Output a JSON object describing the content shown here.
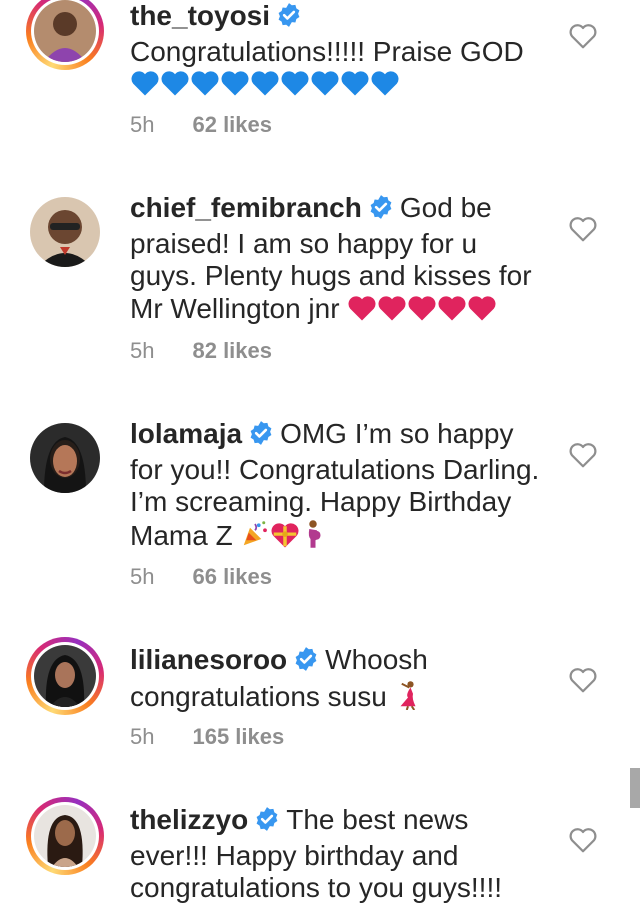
{
  "comments": [
    {
      "username": "the_toyosi",
      "text": "Congratulations!!!!! Praise GOD",
      "emojis": [
        "blue-heart",
        "blue-heart",
        "blue-heart",
        "blue-heart",
        "blue-heart",
        "blue-heart",
        "blue-heart",
        "blue-heart",
        "blue-heart"
      ],
      "time": "5h",
      "likes": "62 likes",
      "story_ring": true
    },
    {
      "username": "chief_femibranch",
      "text": "God be praised! I am so happy for u guys. Plenty hugs and kisses for Mr Wellington jnr",
      "emojis": [
        "red-heart",
        "red-heart",
        "red-heart",
        "red-heart",
        "red-heart"
      ],
      "time": "5h",
      "likes": "82 likes",
      "story_ring": false
    },
    {
      "username": "lolamaja",
      "text": "OMG I’m so happy for you!! Congratulations Darling. I’m screaming. Happy Birthday Mama Z",
      "emojis": [
        "party-popper",
        "heart-with-ribbon",
        "pregnant-woman"
      ],
      "time": "5h",
      "likes": "66 likes",
      "story_ring": false
    },
    {
      "username": "lilianesoroo",
      "text": "Whoosh congratulations susu",
      "emojis": [
        "dancing-woman"
      ],
      "time": "5h",
      "likes": "165 likes",
      "story_ring": true
    },
    {
      "username": "thelizzyo",
      "text": "The best news ever!!! Happy birthday and congratulations to you guys!!!!",
      "emojis": [],
      "time": "",
      "likes": "",
      "story_ring": true
    }
  ],
  "colors": {
    "text": "#262626",
    "meta": "#8e8e8e",
    "verified": "#3897f0",
    "blue_heart": "#1e88e5",
    "red_heart": "#e0245e"
  }
}
